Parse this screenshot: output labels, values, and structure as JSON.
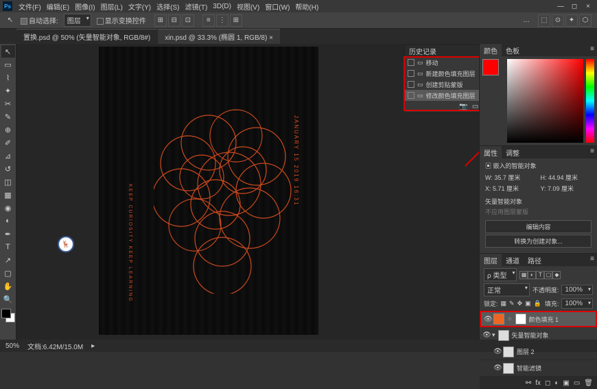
{
  "menu": {
    "ps": "Ps",
    "items": [
      "文件(F)",
      "编辑(E)",
      "图像(I)",
      "图层(L)",
      "文字(Y)",
      "选择(S)",
      "滤镜(T)",
      "3D(D)",
      "视图(V)",
      "窗口(W)",
      "帮助(H)"
    ]
  },
  "optbar": {
    "auto_select": "自动选择:",
    "dropdown": "图层",
    "show_transform": "显示变换控件"
  },
  "tabs": [
    "置换.psd @ 50% (矢量智能对象, RGB/8#)",
    "xin.psd @ 33.3% (椭圆 1, RGB/8)"
  ],
  "canvas": {
    "vtext": "JANUARY 15 2019 16:31",
    "vtext2": "KEEP CURIOSITY KEEP LEARNING"
  },
  "history": {
    "title": "历史记录",
    "items": [
      "移动",
      "新建颜色填充图层",
      "创建剪贴蒙版",
      "修改颜色填充图层"
    ]
  },
  "color": {
    "tabs": [
      "颜色",
      "色板"
    ]
  },
  "props": {
    "tabs": [
      "属性",
      "调整"
    ],
    "type": "嵌入的智能对象",
    "w": "W: 35.7 厘米",
    "h": "H: 44.94 厘米",
    "x": "X: 5.71 厘米",
    "y": "Y: 7.09 厘米",
    "smart": "矢量智能对象",
    "unlink": "不应用图层蒙版",
    "edit": "编辑内容",
    "convert": "转换为创建对象..."
  },
  "layers": {
    "tabs": [
      "图层",
      "通道",
      "路径"
    ],
    "kind": "类型",
    "blend": "正常",
    "opacity_label": "不透明度:",
    "opacity": "100%",
    "lock": "锁定:",
    "fill_label": "填充:",
    "fill": "100%",
    "items": [
      {
        "name": "颜色填充 1",
        "thumb": "orange",
        "mask": true,
        "sel": true
      },
      {
        "name": "矢量智能对象",
        "thumb": "white",
        "mask": false,
        "sel": false
      },
      {
        "name": "图层 2",
        "thumb": "white",
        "mask": false,
        "sel": false,
        "indent": true
      },
      {
        "name": "智能滤镜",
        "thumb": "white",
        "mask": false,
        "sel": false,
        "indent": true
      }
    ]
  },
  "status": {
    "zoom": "50%",
    "doc": "文档:6.42M/15.0M"
  }
}
